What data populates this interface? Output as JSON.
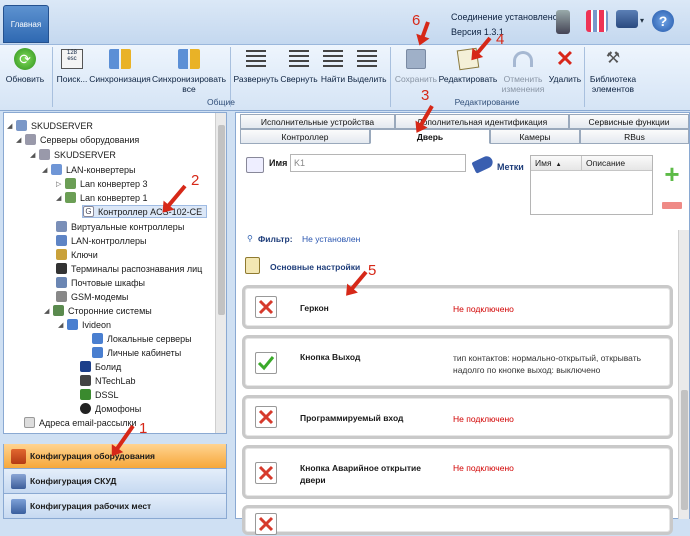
{
  "topbar": {
    "home_tab": "Главная",
    "status_line1": "Соединение установлено",
    "status_line2": "Версия 1.3.1"
  },
  "ribbon": {
    "buttons": {
      "refresh": "Обновить",
      "search": "Поиск...",
      "sync": "Синхронизация",
      "sync_all": "Синхронизировать все",
      "expand": "Развернуть",
      "collapse": "Свернуть",
      "find": "Найти",
      "select": "Выделить",
      "save": "Сохранить",
      "edit": "Редактировать",
      "undo": "Отменить изменения",
      "delete": "Удалить",
      "library": "Библиотека элементов"
    },
    "groups": {
      "general": "Общие",
      "editing": "Редактирование"
    }
  },
  "tree": {
    "items": [
      "SKUDSERVER",
      "Серверы оборудования",
      "SKUDSERVER",
      "LAN-конвертеры",
      "Lan конвертер 3",
      "Lan конвертер 1",
      "Контроллер ACS-102-CE",
      "Виртуальные контроллеры",
      "LAN-контроллеры",
      "Ключи",
      "Терминалы распознавания лиц",
      "Почтовые шкафы",
      "GSM-модемы",
      "Сторонние системы",
      "Ivideon",
      "Локальные серверы",
      "Личные кабинеты",
      "Болид",
      "NTechLab",
      "DSSL",
      "Домофоны",
      "Адреса email-рассылки"
    ]
  },
  "nav": {
    "hardware": "Конфигурация оборудования",
    "acs": "Конфигурация СКУД",
    "workplaces": "Конфигурация рабочих мест"
  },
  "tabs": {
    "row1": [
      "Исполнительные устройства",
      "Дополнительная идентификация",
      "Сервисные функции"
    ],
    "row2": [
      "Контроллер",
      "Дверь",
      "Камеры",
      "RBus"
    ]
  },
  "form": {
    "name_label": "Имя",
    "name_value": "K1",
    "tags_label": "Метки",
    "tags_columns": [
      "Имя",
      "Описание"
    ],
    "filter_label": "Фильтр:",
    "filter_value": "Не установлен",
    "settings_title": "Основные настройки"
  },
  "settings": [
    {
      "title": "Геркон",
      "value": "Не подключено",
      "ok": false
    },
    {
      "title": "Кнопка Выход",
      "value": "тип контактов: нормально-открытый, открывать надолго по кнопке выход: выключено",
      "ok": true
    },
    {
      "title": "Программируемый вход",
      "value": "Не подключено",
      "ok": false
    },
    {
      "title": "Кнопка Аварийное открытие двери",
      "value": "Не подключено",
      "ok": false
    }
  ],
  "callouts": [
    "1",
    "2",
    "3",
    "4",
    "5",
    "6"
  ],
  "colors": {
    "accent": "#2f69b2",
    "nav_active": "#f6a73a",
    "callout": "#d62818",
    "disconnected": "#d20000"
  }
}
